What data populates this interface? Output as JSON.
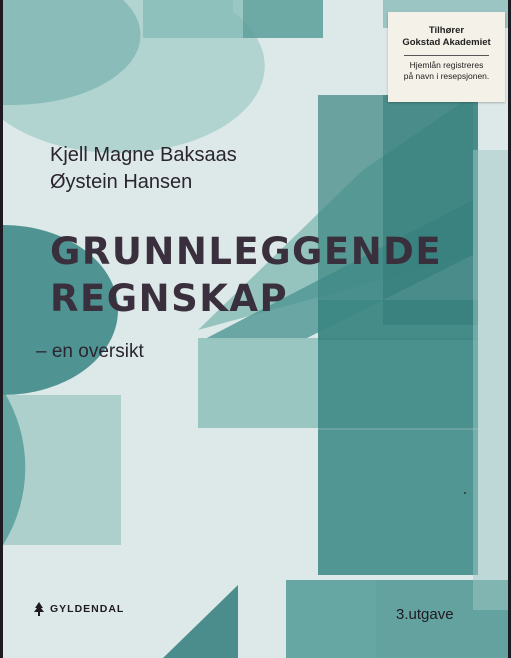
{
  "cover": {
    "authors": [
      "Kjell Magne Baksaas",
      "Øystein Hansen"
    ],
    "title_lines": [
      "GRUNNLEGGENDE",
      "REGNSKAP"
    ],
    "subtitle": "– en oversikt",
    "publisher": "GYLDENDAL",
    "edition": "3.utgave",
    "logo_icon": "spruce-tree-icon"
  },
  "sticker": {
    "owner_line1": "Tilhører",
    "owner_line2": "Gokstad Akademiet",
    "note_line1": "Hjemlån registreres",
    "note_line2": "på navn i resepsjonen."
  },
  "colors": {
    "background": "#dde9e8",
    "teal_dark": "#3b8382",
    "teal_mid": "#5fa09d",
    "teal_light": "#9ec8c4",
    "title": "#3a2f3c"
  }
}
